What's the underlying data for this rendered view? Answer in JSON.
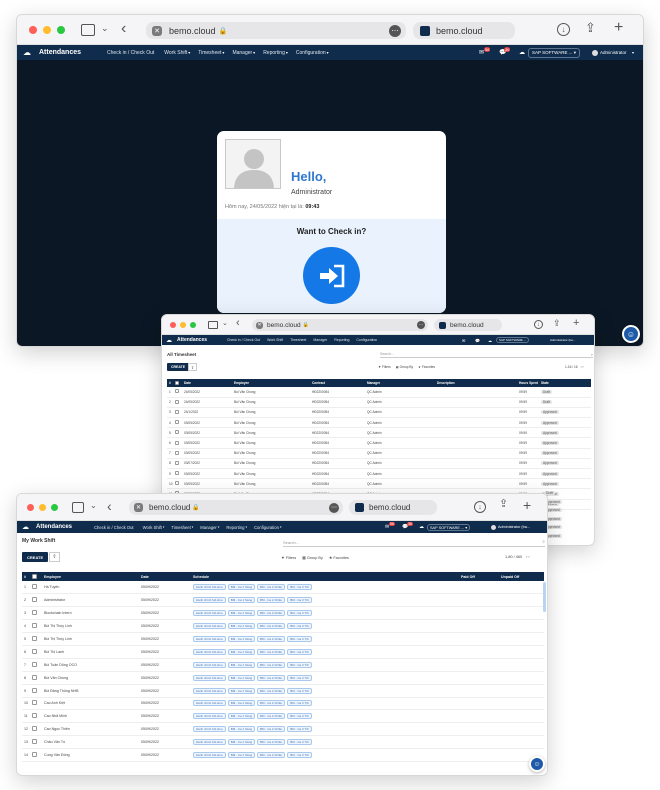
{
  "browser": {
    "url": "bemo.cloud",
    "tab_title": "bemo.cloud",
    "more_icon": "ellipsis-icon"
  },
  "nav": {
    "brand": "Attendances",
    "menu": [
      "Check in / Check Out",
      "Work Shift",
      "Timesheet",
      "Manager",
      "Reporting",
      "Configuration"
    ],
    "badge_activity": "56",
    "badge_messages": "36",
    "company": "SAP SOFTWARE ...",
    "user": "Administrator",
    "user_short": "Administrator (ba..."
  },
  "checkin": {
    "hello": "Hello,",
    "name": "Administrator",
    "now_prefix": "Hôm nay, 24/05/2022 hiện tại là:",
    "now_time": "09:43",
    "question": "Want to Check in?",
    "icon": "sign-in-icon"
  },
  "timesheet": {
    "title": "All Timesheet",
    "create": "CREATE",
    "search_placeholder": "Search...",
    "filters": "Filters",
    "group_by": "Group By",
    "favorites": "Favorites",
    "pager": "1-16 / 16",
    "columns": [
      "#",
      "Date",
      "Employee",
      "Contract",
      "Manager",
      "Description",
      "Hours Spent",
      "State"
    ],
    "rows": [
      [
        "1",
        "24/05/2022",
        "Bùi Văn Chung",
        "HĐ2200054",
        "QC Admin",
        "",
        "09:59",
        "Draft"
      ],
      [
        "2",
        "24/05/2022",
        "Bùi Văn Chung",
        "HĐ2200054",
        "QC Admin",
        "",
        "09:59",
        "Draft"
      ],
      [
        "3",
        "24/1/2022",
        "Bùi Văn Chung",
        "HĐ2200054",
        "QC Admin",
        "",
        "09:59",
        "Approved"
      ],
      [
        "4",
        "03/05/2022",
        "Bùi Văn Chung",
        "HĐ2200054",
        "QC Admin",
        "",
        "09:59",
        "Approved"
      ],
      [
        "5",
        "03/05/2022",
        "Bùi Văn Chung",
        "HĐ2200054",
        "QC Admin",
        "",
        "09:59",
        "Approved"
      ],
      [
        "6",
        "03/05/2022",
        "Bùi Văn Chung",
        "HĐ2200054",
        "QC Admin",
        "",
        "09:59",
        "Approved"
      ],
      [
        "7",
        "03/05/2022",
        "Bùi Văn Chung",
        "HĐ2200054",
        "QC Admin",
        "",
        "09:59",
        "Approved"
      ],
      [
        "8",
        "03/07/2022",
        "Bùi Văn Chung",
        "HĐ2200054",
        "QC Admin",
        "",
        "09:59",
        "Approved"
      ],
      [
        "9",
        "03/05/2022",
        "Bùi Văn Chung",
        "HĐ2200054",
        "QC Admin",
        "",
        "09:59",
        "Approved"
      ],
      [
        "10",
        "03/05/2022",
        "Bùi Văn Chung",
        "HĐ2200054",
        "QC Admin",
        "",
        "09:59",
        "Approved"
      ],
      [
        "11",
        "03/05/2022",
        "Bùi Văn Chung",
        "HĐ2200054",
        "QC Admin",
        "",
        "09:59",
        "Approved"
      ],
      [
        "12",
        "03/05/2022",
        "Bùi Văn Chung",
        "HĐ2200054",
        "QC Admin",
        "",
        "09:59",
        "Approved"
      ]
    ],
    "right_tags": [
      "Draft",
      "Approved",
      "Approved",
      "Approved",
      "Approved",
      "Approved"
    ]
  },
  "workshift": {
    "title": "My Work Shift",
    "create": "CREATE",
    "search_placeholder": "Search...",
    "filters": "Filters",
    "group_by": "Group By",
    "favorites": "Favorites",
    "pager": "1-80 / 460",
    "columns": [
      "#",
      "Employee",
      "Date",
      "Schedule",
      "Paid Off",
      "Unpaid Off"
    ],
    "chips": [
      "Hành chính full-time",
      "BM - Ca 1 Sáng",
      "BM - Ca 2 Chiều",
      "BM - Ca 3 Tối"
    ],
    "rows": [
      [
        "1",
        "Hà Tuyên",
        "05/09/2022"
      ],
      [
        "2",
        "Administrator",
        "05/09/2022"
      ],
      [
        "3",
        "Blockchain Intern",
        "05/09/2022"
      ],
      [
        "4",
        "Bùi Thị Thùy Linh",
        "05/09/2022"
      ],
      [
        "5",
        "Bùi Thị Thùy Linh",
        "05/09/2022"
      ],
      [
        "6",
        "Bùi Thị Lanh",
        "05/09/2022"
      ],
      [
        "7",
        "Bùi Tuấn Dũng OCO",
        "05/09/2022"
      ],
      [
        "8",
        "Bùi Văn Chung",
        "05/09/2022"
      ],
      [
        "9",
        "Bùi Đăng Thông NHB",
        "05/09/2022"
      ],
      [
        "10",
        "Cao Anh Kiệt",
        "05/09/2022"
      ],
      [
        "11",
        "Cao Nhã Minh",
        "05/09/2022"
      ],
      [
        "12",
        "Cao Ngọc Thiên",
        "05/09/2022"
      ],
      [
        "13",
        "Châu Văn Tú",
        "05/09/2022"
      ],
      [
        "14",
        "Cung Văn Đông",
        "05/09/2022"
      ]
    ]
  },
  "colors": {
    "navy": "#0f2c4c",
    "dark_bg": "#0b1724",
    "accent": "#1479e6"
  }
}
